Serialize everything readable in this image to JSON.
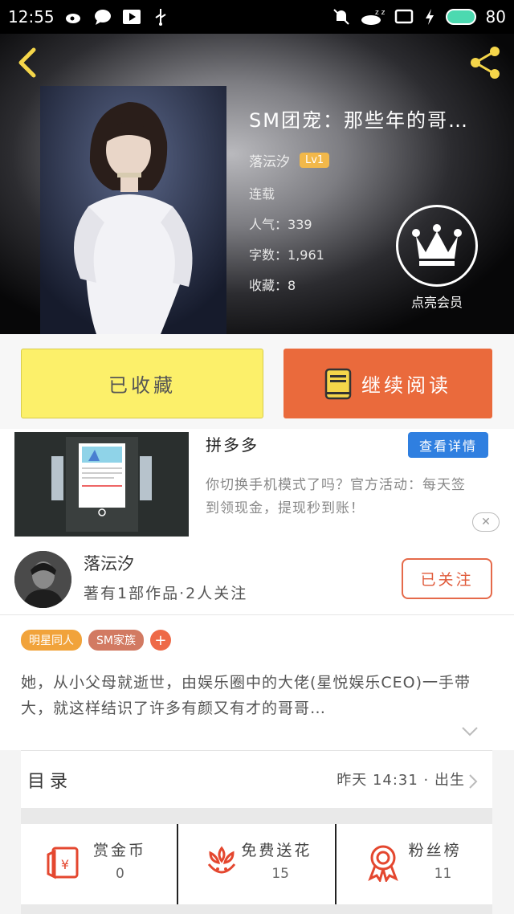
{
  "status_bar": {
    "time": "12:55",
    "battery": "80",
    "left_icons": [
      "weibo-icon",
      "chat-icon",
      "play-icon",
      "usb-icon"
    ],
    "right_icons": [
      "mute-icon",
      "sleep-icon",
      "cast-icon",
      "charging-icon",
      "battery-icon"
    ]
  },
  "book": {
    "title": "SM团宠：那些年的哥…",
    "author": "落沄汐",
    "level": "Lv1",
    "status": "连载",
    "popularity_label": "人气：",
    "popularity": "339",
    "words_label": "字数：",
    "words": "1,961",
    "favorites_label": "收藏：",
    "favorites": "8",
    "vip_label": "点亮会员"
  },
  "actions": {
    "favorited_label": "已收藏",
    "continue_label": "继续阅读"
  },
  "ad": {
    "title": "拼多多",
    "detail_button": "查看详情",
    "description": "你切换手机模式了吗？官方活动：每天签到领现金，提现秒到账！",
    "close": "✕"
  },
  "author_section": {
    "name": "落沄汐",
    "stats": "著有1部作品·2人关注",
    "follow_label": "已关注"
  },
  "tags": [
    "明星同人",
    "SM家族"
  ],
  "tag_add": "+",
  "summary": "她，从小父母就逝世，由娱乐圈中的大佬(星悦娱乐CEO)一手带大，就这样结识了许多有颜又有才的哥哥…",
  "toc": {
    "label": "目录",
    "latest": "昨天 14:31 · 出生"
  },
  "rewards": [
    {
      "label": "赏金币",
      "value": "0",
      "icon": "coin-envelope-icon"
    },
    {
      "label": "免费送花",
      "value": "15",
      "icon": "flower-icon"
    },
    {
      "label": "粉丝榜",
      "value": "11",
      "icon": "medal-icon"
    }
  ],
  "colors": {
    "accent_orange": "#ea6a3c",
    "fav_yellow": "#fcf06a",
    "ad_blue": "#2f7fe0",
    "level_badge": "#f2b84a"
  }
}
